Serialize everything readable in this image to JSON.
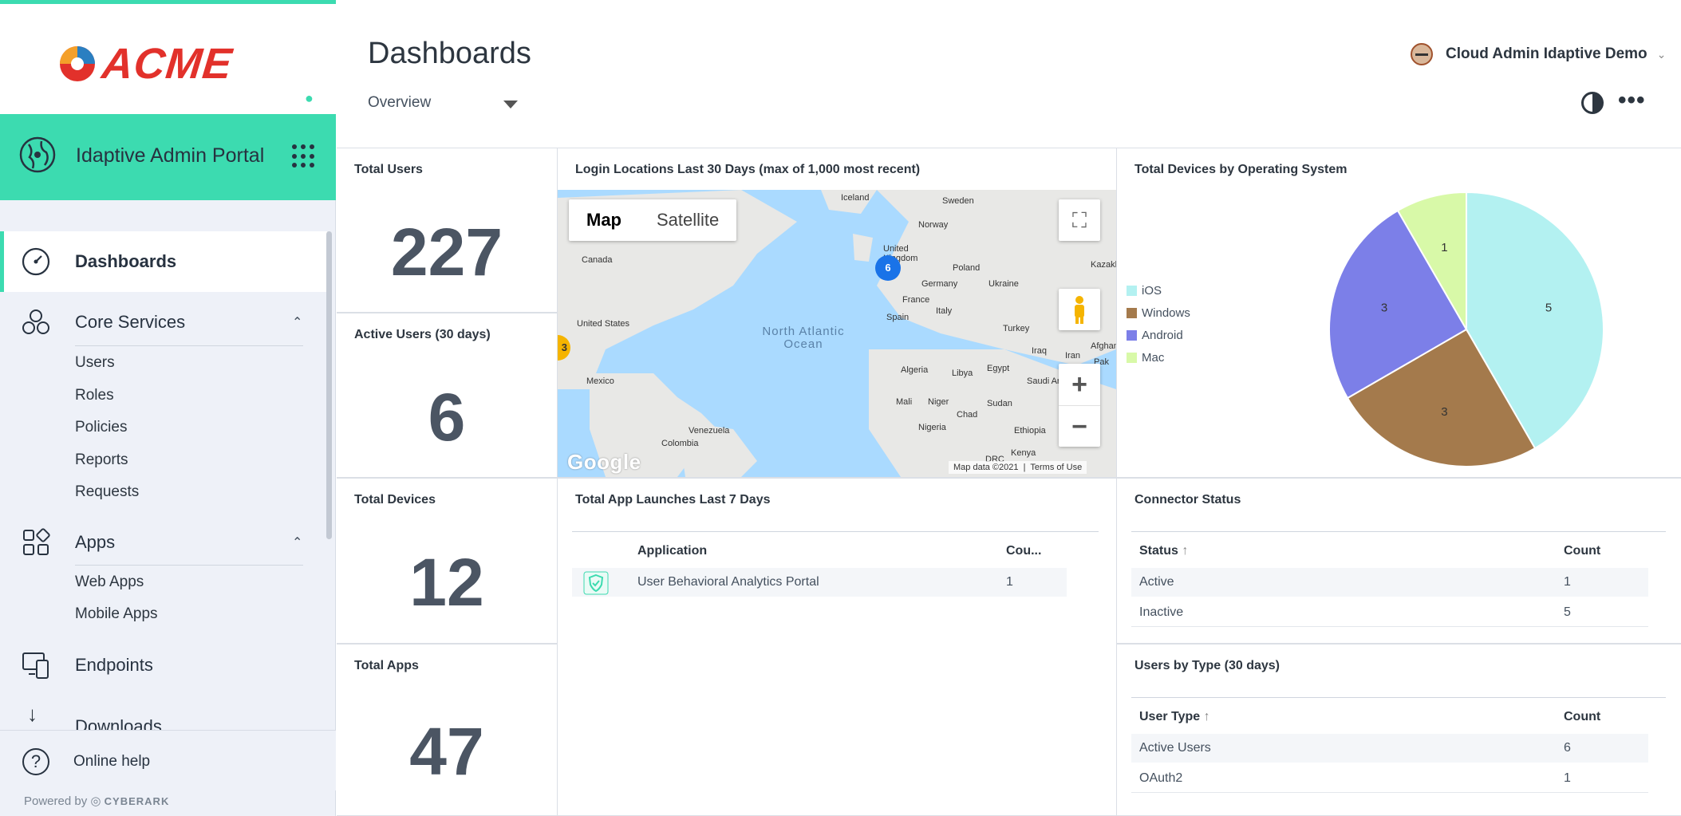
{
  "brand": {
    "logo_text": "ACME",
    "portal_title": "Idaptive Admin Portal",
    "powered_by": "Powered by",
    "powered_brand": "CYBERARK"
  },
  "colors": {
    "accent": "#3cdbb0",
    "logo_red": "#e2312b",
    "ios": "#b3f1f1",
    "windows": "#a47a4c",
    "android": "#7c7fe8",
    "mac": "#d8f9a8"
  },
  "nav": {
    "dashboards": "Dashboards",
    "core_services": "Core Services",
    "core_sub": [
      "Users",
      "Roles",
      "Policies",
      "Reports",
      "Requests"
    ],
    "apps": "Apps",
    "apps_sub": [
      "Web Apps",
      "Mobile Apps"
    ],
    "endpoints": "Endpoints",
    "downloads": "Downloads",
    "help": "Online help"
  },
  "header": {
    "title": "Dashboards",
    "view": "Overview",
    "user": "Cloud Admin Idaptive Demo"
  },
  "cards": {
    "total_users": {
      "title": "Total Users",
      "value": "227"
    },
    "active_users": {
      "title": "Active Users (30 days)",
      "value": "6"
    },
    "total_devices": {
      "title": "Total Devices",
      "value": "12"
    },
    "total_apps": {
      "title": "Total Apps",
      "value": "47"
    },
    "login_map": {
      "title": "Login Locations Last 30 Days (max of 1,000 most recent)",
      "map_tab": "Map",
      "satellite_tab": "Satellite",
      "ocean": "North Atlantic Ocean",
      "footer_data": "Map data ©2021",
      "footer_terms": "Terms of Use",
      "google": "Google",
      "cluster_a": "6",
      "cluster_b": "3",
      "places": [
        "Iceland",
        "Sweden",
        "Norway",
        "United Kingdom",
        "Canada",
        "Poland",
        "Germany",
        "Ukraine",
        "France",
        "Italy",
        "Spain",
        "Turkey",
        "United States",
        "Iraq",
        "Iran",
        "Afghan",
        "Pak",
        "Kazakh",
        "Mexico",
        "Algeria",
        "Libya",
        "Egypt",
        "Saudi Arab",
        "Mali",
        "Niger",
        "Chad",
        "Sudan",
        "Nigeria",
        "Ethiopia",
        "Venezuela",
        "Colombia",
        "Kenya",
        "DRC"
      ]
    },
    "app_launches": {
      "title": "Total App Launches Last 7 Days",
      "col_app": "Application",
      "col_count": "Cou...",
      "rows": [
        {
          "app": "User Behavioral Analytics Portal",
          "count": "1"
        }
      ]
    },
    "devices_os": {
      "title": "Total Devices by Operating System",
      "legend": [
        "iOS",
        "Windows",
        "Android",
        "Mac"
      ]
    },
    "connector": {
      "title": "Connector Status",
      "col_status": "Status",
      "col_count": "Count",
      "rows": [
        {
          "status": "Active",
          "count": "1"
        },
        {
          "status": "Inactive",
          "count": "5"
        }
      ]
    },
    "users_type": {
      "title": "Users by Type (30 days)",
      "col_type": "User Type",
      "col_count": "Count",
      "rows": [
        {
          "type": "Active Users",
          "count": "6"
        },
        {
          "type": "OAuth2",
          "count": "1"
        }
      ]
    }
  },
  "chart_data": {
    "type": "pie",
    "title": "Total Devices by Operating System",
    "categories": [
      "iOS",
      "Windows",
      "Android",
      "Mac"
    ],
    "values": [
      5,
      3,
      3,
      1
    ],
    "colors": [
      "#b3f1f1",
      "#a47a4c",
      "#7c7fe8",
      "#d8f9a8"
    ],
    "legend": "left"
  }
}
